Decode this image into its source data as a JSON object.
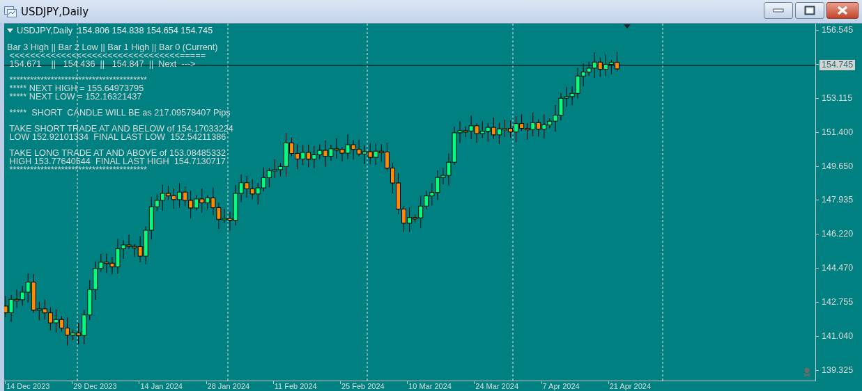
{
  "window": {
    "title": "USDJPY,Daily"
  },
  "chart": {
    "header": {
      "symbol": "USDJPY,Daily",
      "prices": "154.806 154.838 154.654 154.745"
    },
    "info_blocks": [
      [
        "Bar 3 High || Bar 2 Low || Bar 1 High || Bar 0 (Current)",
        " <<<<<<<<<<<<<<<<<<<<<<<<<<<<<<<<<=====",
        " 154.671    ||   154.436  ||   154.847  ||  Next  --->"
      ],
      [
        " ****************************************",
        " ***** NEXT HIGH = 155.64973795",
        " ***** NEXT LOW = 152.16321437"
      ],
      [
        " *****  SHORT  CANDLE WILL BE as 217.09578407 Pips"
      ],
      [
        " TAKE SHORT TRADE AT AND BELOW of 154.17033224",
        " LOW 152.92101334  FINAL LAST LOW  152.54211386"
      ],
      [
        " TAKE LONG TRADE AT AND ABOVE of 153.08485332",
        " HIGH 153.77640544  FINAL LAST HIGH  154.7130717",
        " ****************************************"
      ]
    ],
    "price_axis": {
      "ticks": [
        "156.545",
        "153.115",
        "151.400",
        "149.650",
        "147.935",
        "146.220",
        "144.470",
        "142.755",
        "141.040",
        "139.325"
      ],
      "current_price": "154.745"
    },
    "date_axis": [
      "14 Dec 2023",
      "29 Dec 2023",
      "14 Jan 2024",
      "28 Jan 2024",
      "11 Feb 2024",
      "25 Feb 2024",
      "10 Mar 2024",
      "24 Mar 2024",
      "7 Apr 2024",
      "21 Apr 2024"
    ]
  }
}
